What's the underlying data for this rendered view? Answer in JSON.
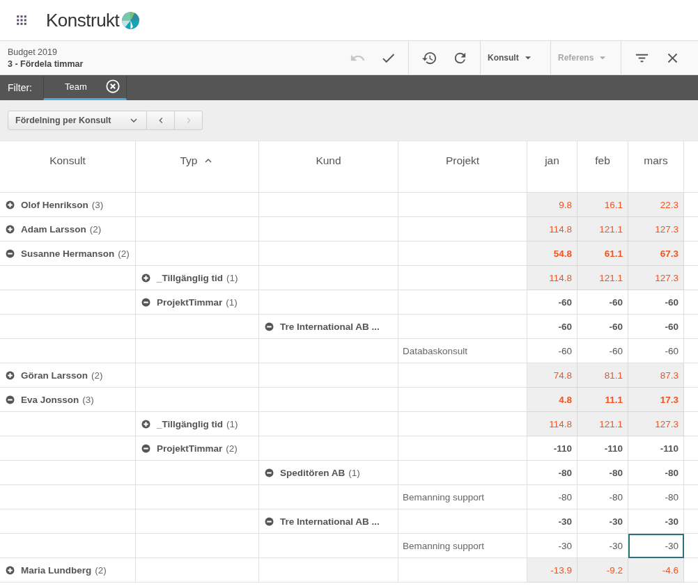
{
  "app": {
    "name": "Konstrukt"
  },
  "toolbar": {
    "title": "Budget 2019",
    "subtitle": "3 - Fördela timmar",
    "groups": [
      [
        {
          "kind": "undo",
          "disabled": true
        },
        {
          "kind": "check",
          "disabled": false
        }
      ],
      [
        {
          "kind": "history",
          "disabled": false
        },
        {
          "kind": "refresh",
          "disabled": false
        }
      ],
      [
        {
          "kind": "dropdown",
          "label": "Konsult",
          "disabled": false
        }
      ],
      [
        {
          "kind": "dropdown",
          "label": "Referens",
          "disabled": true
        }
      ],
      [
        {
          "kind": "filter",
          "disabled": false
        },
        {
          "kind": "close",
          "disabled": false
        }
      ]
    ]
  },
  "filter": {
    "label": "Filter:",
    "chips": [
      {
        "label": "Team",
        "selected": true
      }
    ]
  },
  "view": {
    "label": "Fördelning per Konsult",
    "prev_disabled": false,
    "next_disabled": true
  },
  "columns": [
    {
      "label": "Konsult",
      "sorted": false
    },
    {
      "label": "Typ",
      "sorted": true
    },
    {
      "label": "Kund",
      "sorted": false
    },
    {
      "label": "Projekt",
      "sorted": false
    },
    {
      "label": "jan",
      "sorted": false
    },
    {
      "label": "feb",
      "sorted": false
    },
    {
      "label": "mars",
      "sorted": false
    }
  ],
  "rows": [
    {
      "kind": "group",
      "label": "Olof Henrikson",
      "count": "(3)",
      "expanded": false,
      "highlighted": true,
      "values": [
        {
          "text": "9.8",
          "selected": false
        },
        {
          "text": "16.1",
          "selected": false
        },
        {
          "text": "22.3",
          "selected": false
        }
      ]
    },
    {
      "kind": "group",
      "label": "Adam Larsson",
      "count": "(2)",
      "expanded": false,
      "highlighted": true,
      "values": [
        {
          "text": "114.8",
          "selected": false
        },
        {
          "text": "121.1",
          "selected": false
        },
        {
          "text": "127.3",
          "selected": false
        }
      ]
    },
    {
      "kind": "group",
      "label": "Susanne Hermanson",
      "count": "(2)",
      "expanded": true,
      "highlighted": true,
      "values": [
        {
          "text": "54.8",
          "selected": false
        },
        {
          "text": "61.1",
          "selected": false
        },
        {
          "text": "67.3",
          "selected": false
        }
      ],
      "children": [
        {
          "kind": "group",
          "label": "_Tillgänglig tid",
          "count": "(1)",
          "expanded": false,
          "highlighted": true,
          "values": [
            {
              "text": "114.8",
              "selected": false
            },
            {
              "text": "121.1",
              "selected": false
            },
            {
              "text": "127.3",
              "selected": false
            }
          ]
        },
        {
          "kind": "group",
          "label": "ProjektTimmar",
          "count": "(1)",
          "expanded": true,
          "highlighted": false,
          "values": [
            {
              "text": "-60",
              "selected": false
            },
            {
              "text": "-60",
              "selected": false
            },
            {
              "text": "-60",
              "selected": false
            }
          ],
          "children": [
            {
              "kind": "group",
              "label": "Tre International AB ...",
              "expanded": true,
              "highlighted": false,
              "values": [
                {
                  "text": "-60",
                  "selected": false
                },
                {
                  "text": "-60",
                  "selected": false
                },
                {
                  "text": "-60",
                  "selected": false
                }
              ],
              "children": [
                {
                  "kind": "leaf",
                  "label": "Databaskonsult",
                  "highlighted": false,
                  "values": [
                    {
                      "text": "-60",
                      "selected": false
                    },
                    {
                      "text": "-60",
                      "selected": false
                    },
                    {
                      "text": "-60",
                      "selected": false
                    }
                  ]
                }
              ]
            }
          ]
        }
      ]
    },
    {
      "kind": "group",
      "label": "Göran Larsson",
      "count": "(2)",
      "expanded": false,
      "highlighted": true,
      "values": [
        {
          "text": "74.8",
          "selected": false
        },
        {
          "text": "81.1",
          "selected": false
        },
        {
          "text": "87.3",
          "selected": false
        }
      ]
    },
    {
      "kind": "group",
      "label": "Eva Jonsson",
      "count": "(3)",
      "expanded": true,
      "highlighted": true,
      "values": [
        {
          "text": "4.8",
          "selected": false
        },
        {
          "text": "11.1",
          "selected": false
        },
        {
          "text": "17.3",
          "selected": false
        }
      ],
      "children": [
        {
          "kind": "group",
          "label": "_Tillgänglig tid",
          "count": "(1)",
          "expanded": false,
          "highlighted": true,
          "values": [
            {
              "text": "114.8",
              "selected": false
            },
            {
              "text": "121.1",
              "selected": false
            },
            {
              "text": "127.3",
              "selected": false
            }
          ]
        },
        {
          "kind": "group",
          "label": "ProjektTimmar",
          "count": "(2)",
          "expanded": true,
          "highlighted": false,
          "values": [
            {
              "text": "-110",
              "selected": false
            },
            {
              "text": "-110",
              "selected": false
            },
            {
              "text": "-110",
              "selected": false
            }
          ],
          "children": [
            {
              "kind": "group",
              "label": "Speditören AB",
              "count": "(1)",
              "expanded": true,
              "highlighted": false,
              "values": [
                {
                  "text": "-80",
                  "selected": false
                },
                {
                  "text": "-80",
                  "selected": false
                },
                {
                  "text": "-80",
                  "selected": false
                }
              ],
              "children": [
                {
                  "kind": "leaf",
                  "label": "Bemanning support",
                  "highlighted": false,
                  "values": [
                    {
                      "text": "-80",
                      "selected": false
                    },
                    {
                      "text": "-80",
                      "selected": false
                    },
                    {
                      "text": "-80",
                      "selected": false
                    }
                  ]
                }
              ]
            },
            {
              "kind": "group",
              "label": "Tre International AB ...",
              "expanded": true,
              "highlighted": false,
              "values": [
                {
                  "text": "-30",
                  "selected": false
                },
                {
                  "text": "-30",
                  "selected": false
                },
                {
                  "text": "-30",
                  "selected": false
                }
              ],
              "children": [
                {
                  "kind": "leaf",
                  "label": "Bemanning support",
                  "highlighted": false,
                  "values": [
                    {
                      "text": "-30",
                      "selected": false
                    },
                    {
                      "text": "-30",
                      "selected": false
                    },
                    {
                      "text": "-30",
                      "selected": true
                    }
                  ]
                }
              ]
            }
          ]
        }
      ]
    },
    {
      "kind": "group",
      "label": "Maria Lundberg",
      "count": "(2)",
      "expanded": false,
      "highlighted": true,
      "values": [
        {
          "text": "-13.9",
          "selected": false
        },
        {
          "text": "-9.2",
          "selected": false
        },
        {
          "text": "-4.6",
          "selected": false
        }
      ]
    }
  ]
}
